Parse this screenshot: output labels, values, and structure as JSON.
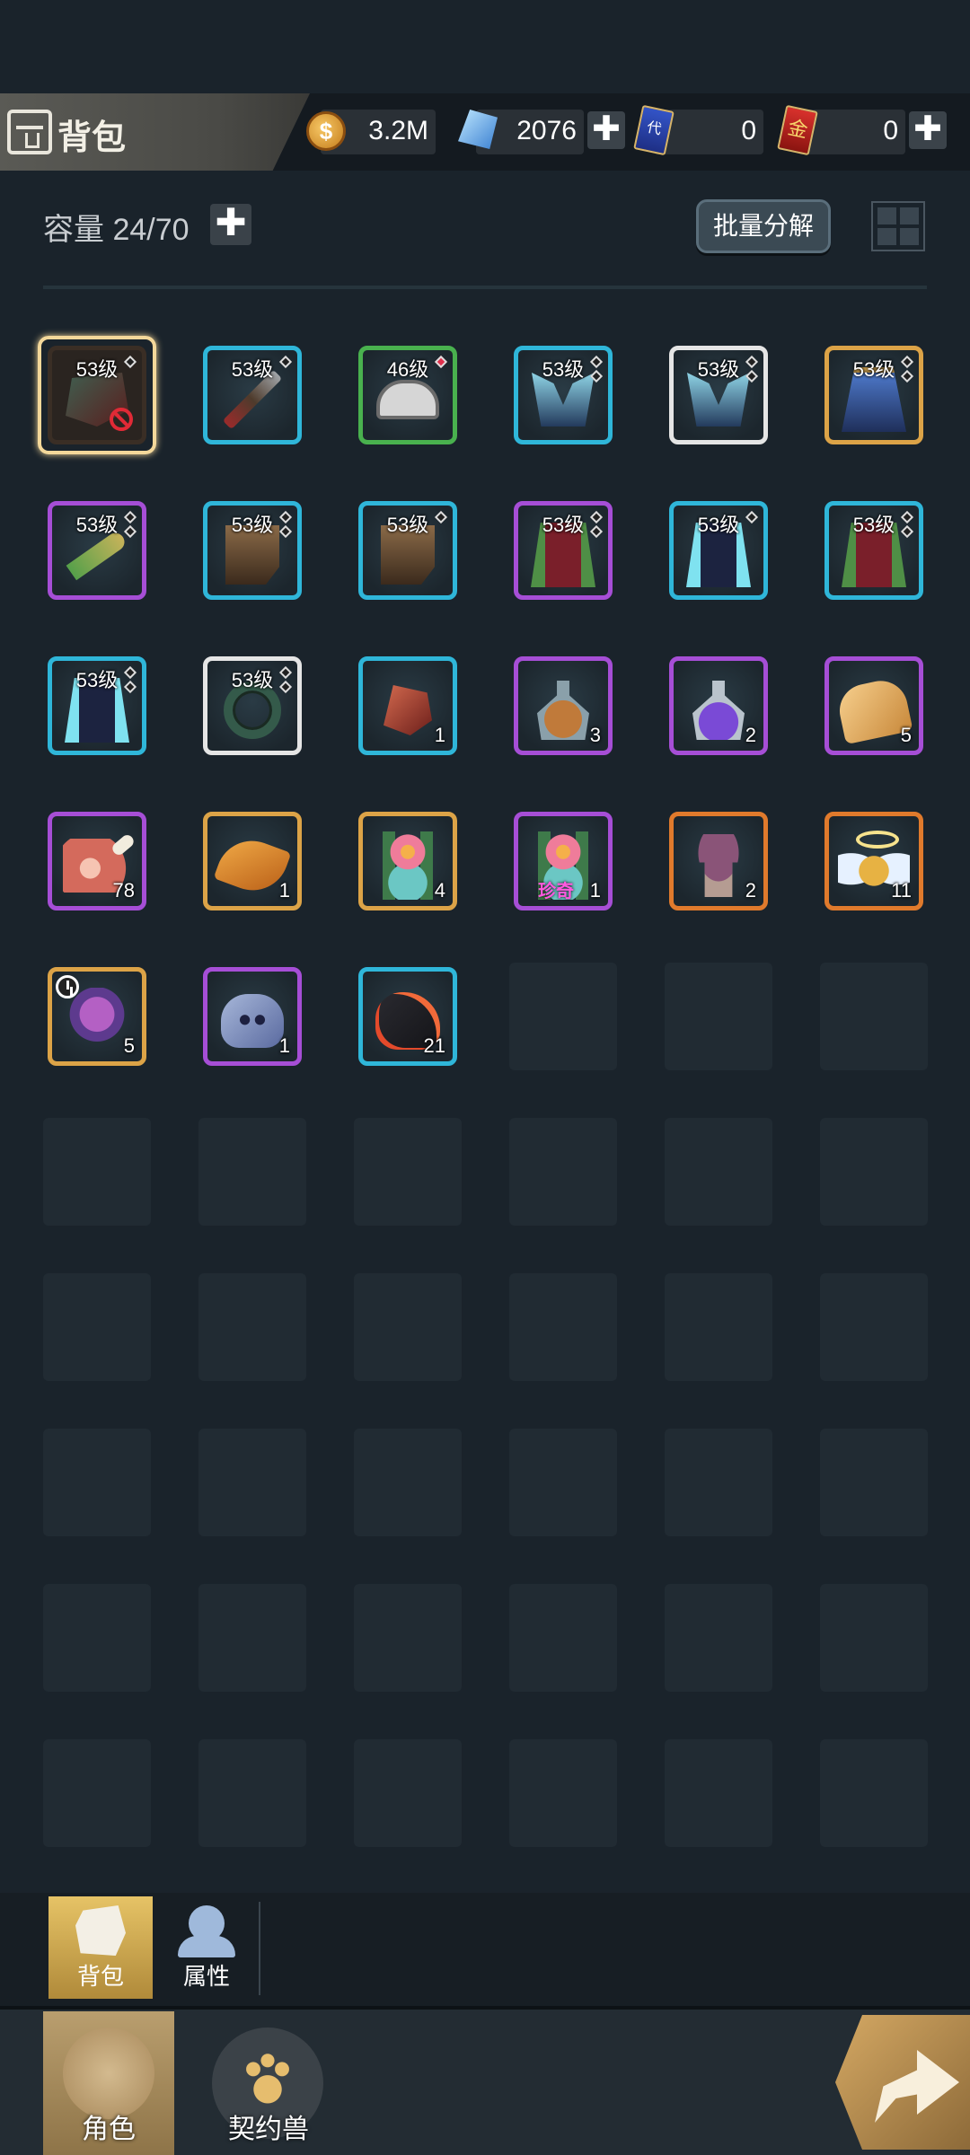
{
  "header": {
    "title": "背包",
    "gold": "3.2M",
    "diamonds": "2076",
    "card_blue_icon_text": "代",
    "card_blue": "0",
    "card_red_icon_text": "金",
    "card_red": "0",
    "plus_symbol": "✚"
  },
  "capacity": {
    "label": "容量 24/70",
    "add_symbol": "✚"
  },
  "toolbar": {
    "batch_decompose": "批量分解"
  },
  "inventory": [
    {
      "level": "53级",
      "count": "",
      "rarity": "brown",
      "art": "helmdark",
      "selected": true,
      "locked": true
    },
    {
      "level": "53级",
      "count": "",
      "rarity": "blue",
      "art": "weapon"
    },
    {
      "level": "46级",
      "count": "",
      "rarity": "green",
      "art": "helm",
      "red_pip": true
    },
    {
      "level": "53级",
      "count": "",
      "rarity": "blue",
      "art": "armor",
      "pip2": true
    },
    {
      "level": "53级",
      "count": "",
      "rarity": "white",
      "art": "armor",
      "pip2": true
    },
    {
      "level": "53级",
      "count": "",
      "rarity": "gold",
      "art": "robe",
      "pip2": true
    },
    {
      "level": "53级",
      "count": "",
      "rarity": "purple",
      "art": "knife",
      "pip2": true
    },
    {
      "level": "53级",
      "count": "",
      "rarity": "blue",
      "art": "boots",
      "pip2": true
    },
    {
      "level": "53级",
      "count": "",
      "rarity": "blue",
      "art": "boots"
    },
    {
      "level": "53级",
      "count": "",
      "rarity": "purple",
      "art": "cloak",
      "pip2": true
    },
    {
      "level": "53级",
      "count": "",
      "rarity": "blue",
      "art": "cloak2"
    },
    {
      "level": "53级",
      "count": "",
      "rarity": "blue",
      "art": "cloak",
      "pip2": true
    },
    {
      "level": "53级",
      "count": "",
      "rarity": "blue",
      "art": "cloak2",
      "pip2": true
    },
    {
      "level": "53级",
      "count": "",
      "rarity": "white",
      "art": "ring",
      "pip2": true
    },
    {
      "level": "",
      "count": "1",
      "rarity": "blue",
      "art": "ore"
    },
    {
      "level": "",
      "count": "3",
      "rarity": "purple",
      "art": "potion"
    },
    {
      "level": "",
      "count": "2",
      "rarity": "purple",
      "art": "potion purple"
    },
    {
      "level": "",
      "count": "5",
      "rarity": "purple",
      "art": "bread"
    },
    {
      "level": "",
      "count": "78",
      "rarity": "purple",
      "art": "meat"
    },
    {
      "level": "",
      "count": "1",
      "rarity": "gold",
      "art": "wing"
    },
    {
      "level": "",
      "count": "4",
      "rarity": "gold",
      "art": "flower"
    },
    {
      "level": "",
      "count": "1",
      "rarity": "purple",
      "art": "flower",
      "rare_label": "珍奇"
    },
    {
      "level": "",
      "count": "2",
      "rarity": "orange",
      "art": "mushroom"
    },
    {
      "level": "",
      "count": "11",
      "rarity": "orange",
      "art": "angel"
    },
    {
      "level": "",
      "count": "5",
      "rarity": "gold",
      "art": "mask",
      "timed": true
    },
    {
      "level": "",
      "count": "1",
      "rarity": "purple",
      "art": "skull"
    },
    {
      "level": "",
      "count": "21",
      "rarity": "blue",
      "art": "lava"
    }
  ],
  "subtabs": {
    "bag": "背包",
    "attributes": "属性"
  },
  "bottom_nav": {
    "character": "角色",
    "contract_beast": "契约兽"
  }
}
